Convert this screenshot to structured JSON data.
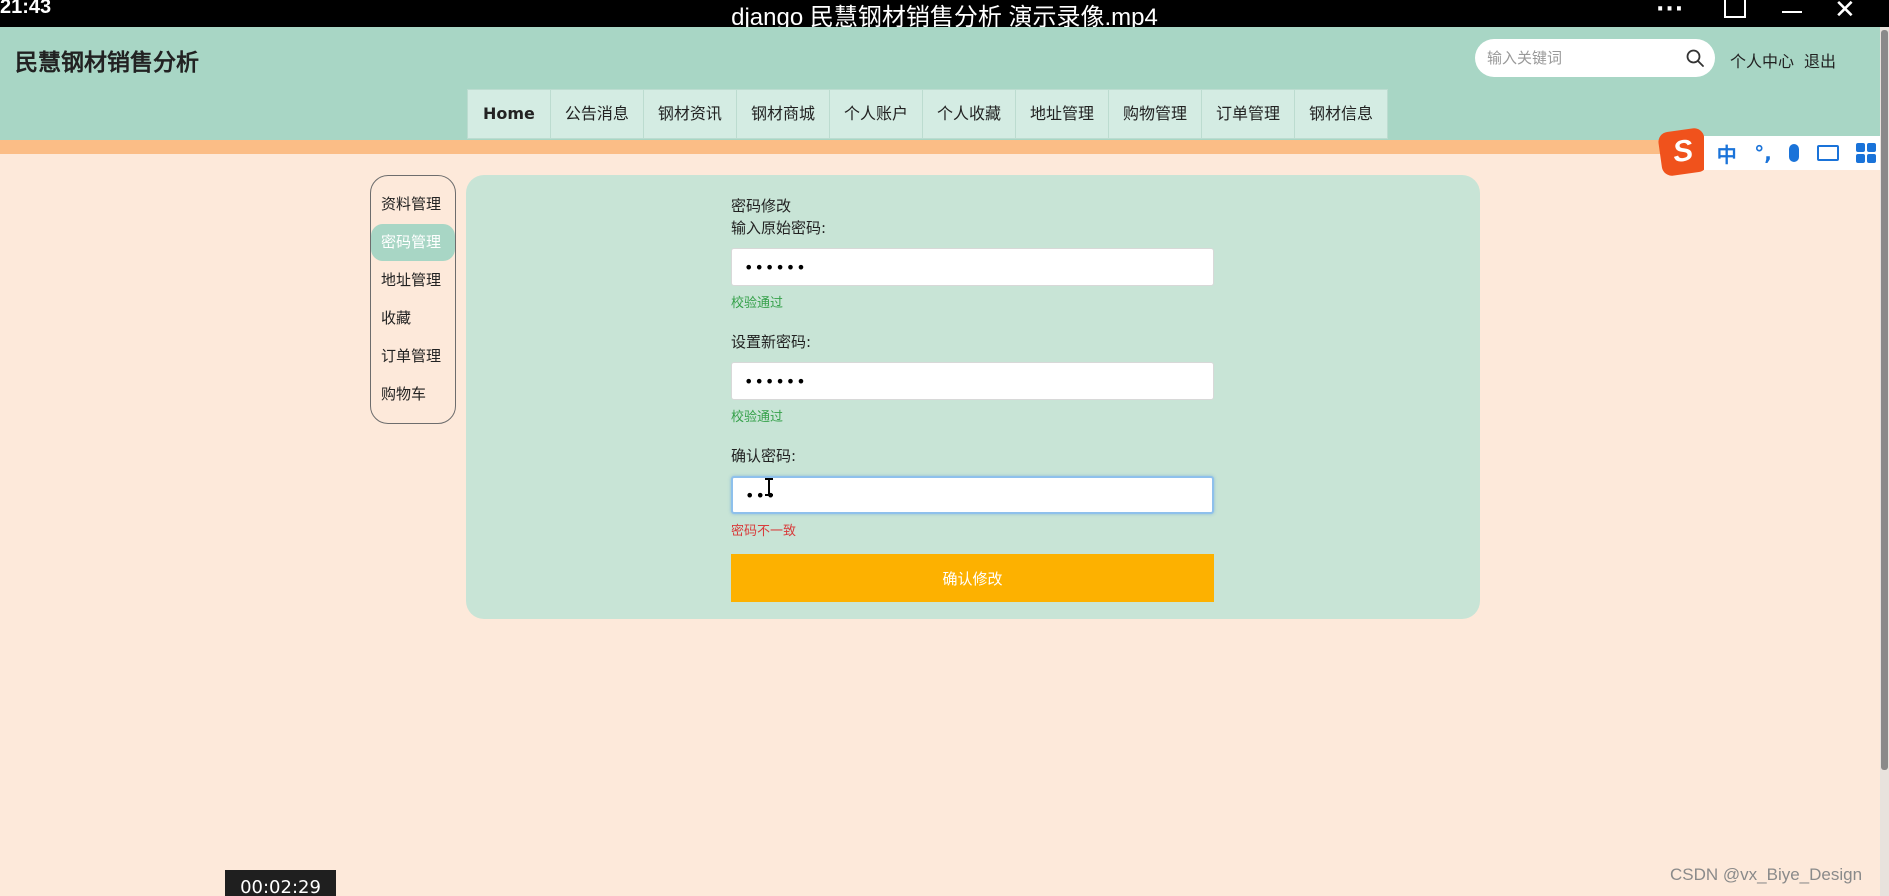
{
  "player": {
    "clock": "21:43",
    "title": "django 民慧钢材销售分析 演示录像.mp4",
    "more": "···",
    "close": "✕",
    "time": "00:02:29"
  },
  "site": {
    "title": "民慧钢材销售分析"
  },
  "search": {
    "placeholder": "输入关键词"
  },
  "header_links": {
    "personal_center": "个人中心",
    "logout": "退出"
  },
  "nav": {
    "items": [
      "Home",
      "公告消息",
      "钢材资讯",
      "钢材商城",
      "个人账户",
      "个人收藏",
      "地址管理",
      "购物管理",
      "订单管理",
      "钢材信息"
    ]
  },
  "ime": {
    "logo": "S",
    "mode": "中",
    "punct": "°,"
  },
  "side_menu": {
    "items": [
      "资料管理",
      "密码管理",
      "地址管理",
      "收藏",
      "订单管理",
      "购物车"
    ],
    "active_index": 1
  },
  "form": {
    "heading": "密码修改",
    "old_label": "输入原始密码:",
    "old_value": "123456",
    "old_hint": "校验通过",
    "new_label": "设置新密码:",
    "new_value": "123456",
    "new_hint": "校验通过",
    "confirm_label": "确认密码:",
    "confirm_value": "123",
    "confirm_hint": "密码不一致",
    "submit": "确认修改"
  },
  "watermark": "CSDN @vx_Biye_Design",
  "colors": {
    "header_bg": "#a8d6c5",
    "page_bg": "#fde9da",
    "accent_strip": "#fbbd86",
    "panel_bg": "#c8e4d6",
    "button": "#fdb100",
    "ok": "#35a14a",
    "error": "#d83b3b"
  }
}
